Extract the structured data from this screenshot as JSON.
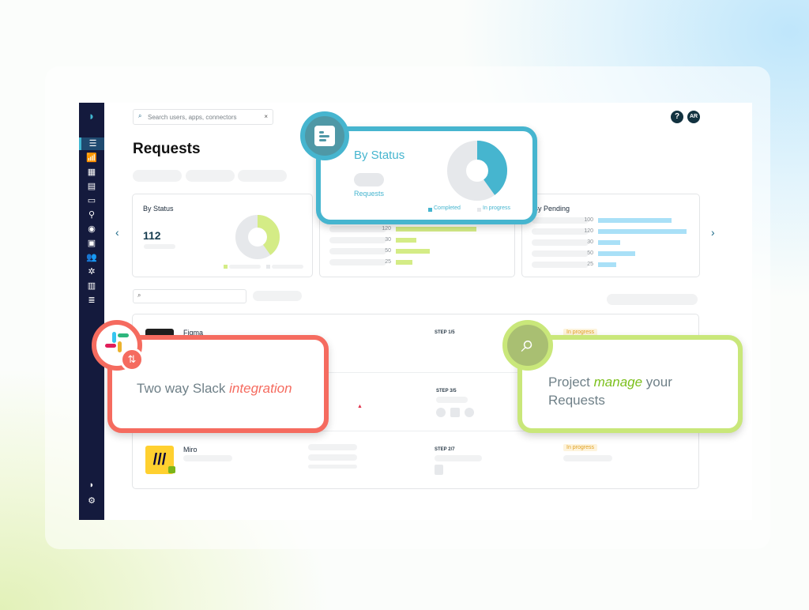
{
  "search": {
    "placeholder": "Search users, apps, connectors"
  },
  "header": {
    "help": "?",
    "avatar": "AR"
  },
  "page_title": "Requests",
  "cards": {
    "by_status": {
      "title": "By Status",
      "count": "112",
      "completed_fraction": 0.4,
      "colors": {
        "completed": "#d4ec86",
        "in_progress": "#e6e8eb"
      }
    },
    "middle": {
      "values": [
        "120",
        "30",
        "50",
        "25"
      ]
    },
    "by_pending": {
      "title": "By Pending",
      "values": [
        "100",
        "120",
        "30",
        "50",
        "25"
      ]
    }
  },
  "popup_status": {
    "title": "By Status",
    "subtitle": "Requests",
    "legend": [
      "Completed",
      "In progress"
    ],
    "completed_fraction": 0.4,
    "color": "#46b5cf"
  },
  "rows": [
    {
      "app": "Figma",
      "step": "STEP 1/5",
      "status": "In progress"
    },
    {
      "app": "",
      "step": "STEP 3/5",
      "status": ""
    },
    {
      "app": "Miro",
      "step": "STEP 2/7",
      "status": "In progress"
    }
  ],
  "callouts": {
    "slack": {
      "text": "Two way Slack ",
      "emph": "integration",
      "color": "#f56b5f"
    },
    "project": {
      "text1": "Project ",
      "emph": "manage",
      "text2": " your Requests",
      "color": "#c9e77a"
    }
  }
}
